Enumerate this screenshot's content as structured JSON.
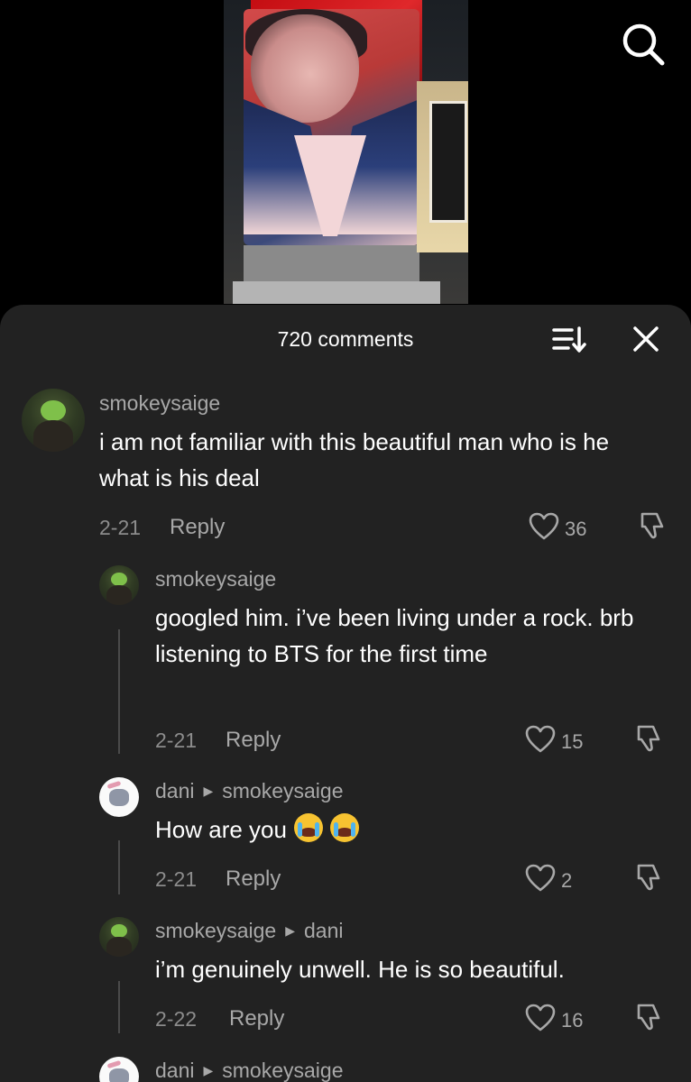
{
  "header": {
    "comment_count": "720 comments"
  },
  "icons": {
    "search": "search-icon",
    "sort": "sort-icon",
    "close": "close-icon",
    "like": "heart-icon",
    "dislike": "thumbs-down-icon",
    "reply_arrow": "reply-to-arrow-icon"
  },
  "colors": {
    "sheet_bg": "#222222",
    "muted_text": "#a8a8a8"
  },
  "comments": [
    {
      "username": "smokeysaige",
      "reply_to": "",
      "text": "i am not familiar with this beautiful man who is he what is his deal",
      "date": "2-21",
      "reply_label": "Reply",
      "likes": "36"
    },
    {
      "username": "smokeysaige",
      "reply_to": "",
      "text": "googled him. i’ve been living under a rock. brb listening to BTS for the first time",
      "date": "2-21",
      "reply_label": "Reply",
      "likes": "15"
    },
    {
      "username": "dani",
      "reply_to": "smokeysaige",
      "text": "How are you",
      "emoji": "😭😭",
      "date": "2-21",
      "reply_label": "Reply",
      "likes": "2"
    },
    {
      "username": "smokeysaige",
      "reply_to": "dani",
      "text": "i’m genuinely unwell. He is so beautiful.",
      "date": "2-22",
      "reply_label": "Reply",
      "likes": "16"
    },
    {
      "username": "dani",
      "reply_to": "smokeysaige",
      "text": "",
      "date": "",
      "reply_label": "",
      "likes": ""
    }
  ]
}
